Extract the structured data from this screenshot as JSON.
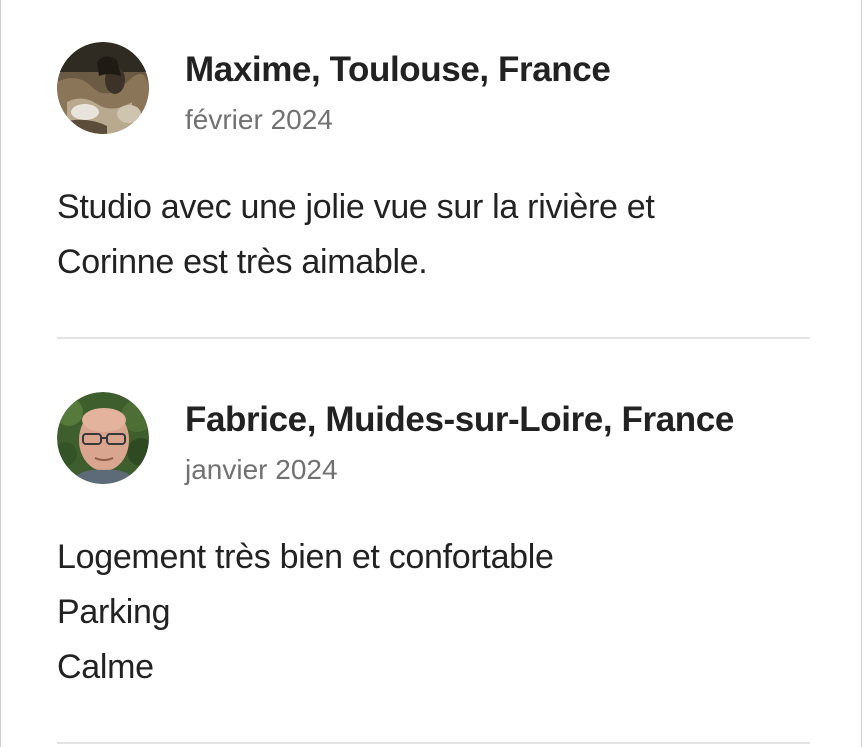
{
  "reviews": [
    {
      "author": "Maxime, Toulouse, France",
      "date": "février 2024",
      "avatar_icon": "user-photo-avatar",
      "text_lines": [
        "Studio avec une jolie vue sur la rivière et",
        "Corinne est très aimable."
      ]
    },
    {
      "author": "Fabrice, Muides-sur-Loire, France",
      "date": "janvier 2024",
      "avatar_icon": "user-photo-avatar",
      "text_lines": [
        "Logement très bien et confortable",
        "Parking",
        "Calme"
      ]
    }
  ],
  "colors": {
    "text": "#222222",
    "secondary_text": "#717171",
    "divider": "#e3e3e3",
    "background": "#ffffff"
  }
}
